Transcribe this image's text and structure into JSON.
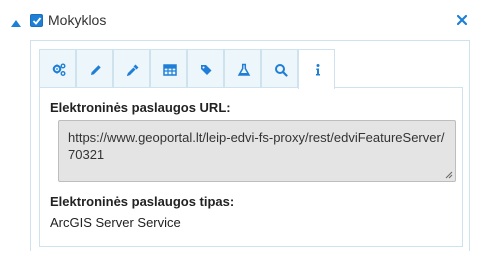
{
  "layer": {
    "name": "Mokyklos",
    "checked": true
  },
  "tabs": [
    {
      "icon": "gears-icon",
      "active": false
    },
    {
      "icon": "pencil-icon",
      "active": false
    },
    {
      "icon": "eyedropper-icon",
      "active": false
    },
    {
      "icon": "table-icon",
      "active": false
    },
    {
      "icon": "tags-icon",
      "active": false
    },
    {
      "icon": "flask-icon",
      "active": false
    },
    {
      "icon": "search-icon",
      "active": false
    },
    {
      "icon": "info-icon",
      "active": true
    }
  ],
  "info": {
    "url_label": "Elektroninės paslaugos URL:",
    "url_value": "https://www.geoportal.lt/leip-edvi-fs-proxy/rest/edviFeatureServer/70321",
    "type_label": "Elektroninės paslaugos tipas:",
    "type_value": "ArcGIS Server Service"
  },
  "colors": {
    "accent": "#1f7fd6",
    "tab_bg": "#edf6fb",
    "border": "#cfe3ee",
    "field_bg": "#e4e4e4"
  }
}
